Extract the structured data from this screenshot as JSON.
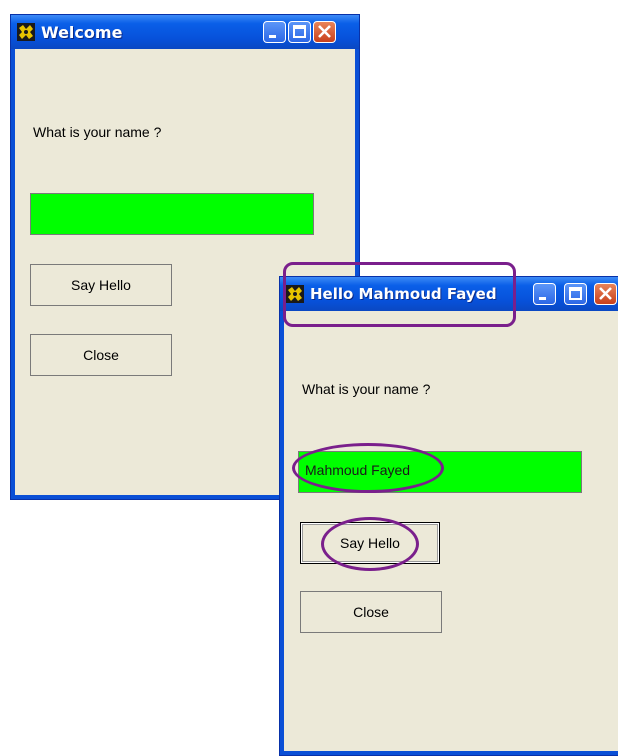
{
  "colors": {
    "titlebar": "#0a5fe8",
    "client": "#ece9d8",
    "field": "#00ff00",
    "annotation": "#7a1f8c"
  },
  "window1": {
    "title": "Welcome",
    "prompt": "What is your name ?",
    "name_value": "",
    "say_hello": "Say Hello",
    "close": "Close"
  },
  "window2": {
    "title": "Hello Mahmoud Fayed",
    "prompt": "What is your name ?",
    "name_value": "Mahmoud Fayed",
    "say_hello": "Say Hello",
    "close": "Close"
  },
  "icons": {
    "app": "app-icon",
    "minimize": "minimize-icon",
    "maximize": "maximize-icon",
    "close": "close-icon"
  }
}
